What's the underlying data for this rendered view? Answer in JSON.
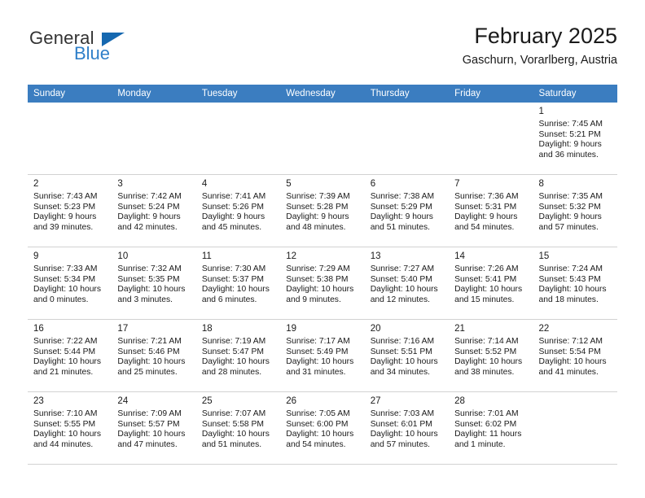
{
  "brand": {
    "word_one": "General",
    "word_two": "Blue",
    "logo_icon": "triangle-flag-icon"
  },
  "header": {
    "title": "February 2025",
    "subtitle": "Gaschurn, Vorarlberg, Austria"
  },
  "calendar": {
    "weekday_headers": [
      "Sunday",
      "Monday",
      "Tuesday",
      "Wednesday",
      "Thursday",
      "Friday",
      "Saturday"
    ],
    "accent_color": "#3b7dc0",
    "shaded_row_color": "#f2f2f2",
    "weeks": [
      [
        {
          "day": "",
          "sunrise": "",
          "sunset": "",
          "daylight": "",
          "daylight2": ""
        },
        {
          "day": "",
          "sunrise": "",
          "sunset": "",
          "daylight": "",
          "daylight2": ""
        },
        {
          "day": "",
          "sunrise": "",
          "sunset": "",
          "daylight": "",
          "daylight2": ""
        },
        {
          "day": "",
          "sunrise": "",
          "sunset": "",
          "daylight": "",
          "daylight2": ""
        },
        {
          "day": "",
          "sunrise": "",
          "sunset": "",
          "daylight": "",
          "daylight2": ""
        },
        {
          "day": "",
          "sunrise": "",
          "sunset": "",
          "daylight": "",
          "daylight2": ""
        },
        {
          "day": "1",
          "sunrise": "Sunrise: 7:45 AM",
          "sunset": "Sunset: 5:21 PM",
          "daylight": "Daylight: 9 hours",
          "daylight2": "and 36 minutes."
        }
      ],
      [
        {
          "day": "2",
          "sunrise": "Sunrise: 7:43 AM",
          "sunset": "Sunset: 5:23 PM",
          "daylight": "Daylight: 9 hours",
          "daylight2": "and 39 minutes."
        },
        {
          "day": "3",
          "sunrise": "Sunrise: 7:42 AM",
          "sunset": "Sunset: 5:24 PM",
          "daylight": "Daylight: 9 hours",
          "daylight2": "and 42 minutes."
        },
        {
          "day": "4",
          "sunrise": "Sunrise: 7:41 AM",
          "sunset": "Sunset: 5:26 PM",
          "daylight": "Daylight: 9 hours",
          "daylight2": "and 45 minutes."
        },
        {
          "day": "5",
          "sunrise": "Sunrise: 7:39 AM",
          "sunset": "Sunset: 5:28 PM",
          "daylight": "Daylight: 9 hours",
          "daylight2": "and 48 minutes."
        },
        {
          "day": "6",
          "sunrise": "Sunrise: 7:38 AM",
          "sunset": "Sunset: 5:29 PM",
          "daylight": "Daylight: 9 hours",
          "daylight2": "and 51 minutes."
        },
        {
          "day": "7",
          "sunrise": "Sunrise: 7:36 AM",
          "sunset": "Sunset: 5:31 PM",
          "daylight": "Daylight: 9 hours",
          "daylight2": "and 54 minutes."
        },
        {
          "day": "8",
          "sunrise": "Sunrise: 7:35 AM",
          "sunset": "Sunset: 5:32 PM",
          "daylight": "Daylight: 9 hours",
          "daylight2": "and 57 minutes."
        }
      ],
      [
        {
          "day": "9",
          "sunrise": "Sunrise: 7:33 AM",
          "sunset": "Sunset: 5:34 PM",
          "daylight": "Daylight: 10 hours",
          "daylight2": "and 0 minutes."
        },
        {
          "day": "10",
          "sunrise": "Sunrise: 7:32 AM",
          "sunset": "Sunset: 5:35 PM",
          "daylight": "Daylight: 10 hours",
          "daylight2": "and 3 minutes."
        },
        {
          "day": "11",
          "sunrise": "Sunrise: 7:30 AM",
          "sunset": "Sunset: 5:37 PM",
          "daylight": "Daylight: 10 hours",
          "daylight2": "and 6 minutes."
        },
        {
          "day": "12",
          "sunrise": "Sunrise: 7:29 AM",
          "sunset": "Sunset: 5:38 PM",
          "daylight": "Daylight: 10 hours",
          "daylight2": "and 9 minutes."
        },
        {
          "day": "13",
          "sunrise": "Sunrise: 7:27 AM",
          "sunset": "Sunset: 5:40 PM",
          "daylight": "Daylight: 10 hours",
          "daylight2": "and 12 minutes."
        },
        {
          "day": "14",
          "sunrise": "Sunrise: 7:26 AM",
          "sunset": "Sunset: 5:41 PM",
          "daylight": "Daylight: 10 hours",
          "daylight2": "and 15 minutes."
        },
        {
          "day": "15",
          "sunrise": "Sunrise: 7:24 AM",
          "sunset": "Sunset: 5:43 PM",
          "daylight": "Daylight: 10 hours",
          "daylight2": "and 18 minutes."
        }
      ],
      [
        {
          "day": "16",
          "sunrise": "Sunrise: 7:22 AM",
          "sunset": "Sunset: 5:44 PM",
          "daylight": "Daylight: 10 hours",
          "daylight2": "and 21 minutes."
        },
        {
          "day": "17",
          "sunrise": "Sunrise: 7:21 AM",
          "sunset": "Sunset: 5:46 PM",
          "daylight": "Daylight: 10 hours",
          "daylight2": "and 25 minutes."
        },
        {
          "day": "18",
          "sunrise": "Sunrise: 7:19 AM",
          "sunset": "Sunset: 5:47 PM",
          "daylight": "Daylight: 10 hours",
          "daylight2": "and 28 minutes."
        },
        {
          "day": "19",
          "sunrise": "Sunrise: 7:17 AM",
          "sunset": "Sunset: 5:49 PM",
          "daylight": "Daylight: 10 hours",
          "daylight2": "and 31 minutes."
        },
        {
          "day": "20",
          "sunrise": "Sunrise: 7:16 AM",
          "sunset": "Sunset: 5:51 PM",
          "daylight": "Daylight: 10 hours",
          "daylight2": "and 34 minutes."
        },
        {
          "day": "21",
          "sunrise": "Sunrise: 7:14 AM",
          "sunset": "Sunset: 5:52 PM",
          "daylight": "Daylight: 10 hours",
          "daylight2": "and 38 minutes."
        },
        {
          "day": "22",
          "sunrise": "Sunrise: 7:12 AM",
          "sunset": "Sunset: 5:54 PM",
          "daylight": "Daylight: 10 hours",
          "daylight2": "and 41 minutes."
        }
      ],
      [
        {
          "day": "23",
          "sunrise": "Sunrise: 7:10 AM",
          "sunset": "Sunset: 5:55 PM",
          "daylight": "Daylight: 10 hours",
          "daylight2": "and 44 minutes."
        },
        {
          "day": "24",
          "sunrise": "Sunrise: 7:09 AM",
          "sunset": "Sunset: 5:57 PM",
          "daylight": "Daylight: 10 hours",
          "daylight2": "and 47 minutes."
        },
        {
          "day": "25",
          "sunrise": "Sunrise: 7:07 AM",
          "sunset": "Sunset: 5:58 PM",
          "daylight": "Daylight: 10 hours",
          "daylight2": "and 51 minutes."
        },
        {
          "day": "26",
          "sunrise": "Sunrise: 7:05 AM",
          "sunset": "Sunset: 6:00 PM",
          "daylight": "Daylight: 10 hours",
          "daylight2": "and 54 minutes."
        },
        {
          "day": "27",
          "sunrise": "Sunrise: 7:03 AM",
          "sunset": "Sunset: 6:01 PM",
          "daylight": "Daylight: 10 hours",
          "daylight2": "and 57 minutes."
        },
        {
          "day": "28",
          "sunrise": "Sunrise: 7:01 AM",
          "sunset": "Sunset: 6:02 PM",
          "daylight": "Daylight: 11 hours",
          "daylight2": "and 1 minute."
        },
        {
          "day": "",
          "sunrise": "",
          "sunset": "",
          "daylight": "",
          "daylight2": ""
        }
      ]
    ]
  }
}
